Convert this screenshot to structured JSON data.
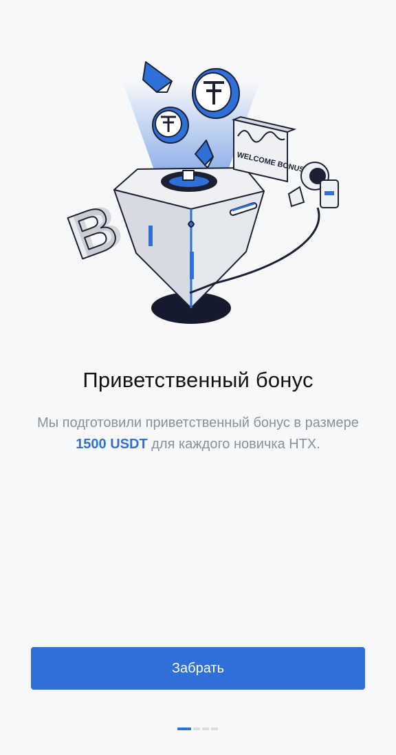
{
  "illustration": {
    "welcome_sign": "WELCOME BONUS",
    "icons": [
      "ethereum-icon",
      "tether-icon",
      "bitcoin-icon",
      "astronaut-icon",
      "diamond-funnel-icon"
    ]
  },
  "title": "Приветственный бонус",
  "description": {
    "before": "Мы подготовили приветственный бонус в размере ",
    "highlight": "1500 USDT",
    "after": " для каждого новичка HTX."
  },
  "button": {
    "label": "Забрать"
  },
  "pagination": {
    "current": 1,
    "total": 4
  },
  "colors": {
    "accent": "#2f6fd8",
    "background": "#f7f8fa"
  }
}
